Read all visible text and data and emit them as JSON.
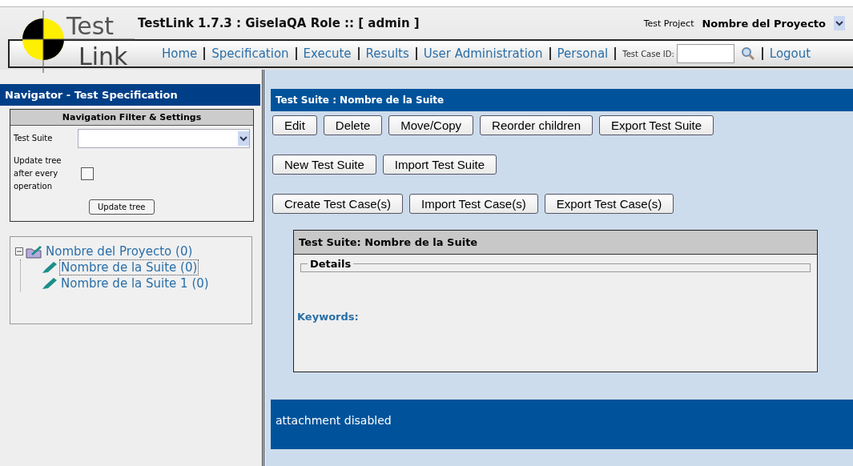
{
  "logo": {
    "line1": "Test",
    "line2": "Link"
  },
  "header": {
    "title": "TestLink 1.7.3 : GiselaQA Role :: [ admin ]",
    "project_label": "Test Project",
    "project_name": "Nombre del Proyecto"
  },
  "nav": {
    "links": [
      "Home",
      "Specification",
      "Execute",
      "Results",
      "User Administration",
      "Personal"
    ],
    "test_case_id_label": "Test Case ID:",
    "logout": "Logout"
  },
  "navigator": {
    "title": "Navigator - Test Specification",
    "filter_title": "Navigation Filter & Settings",
    "test_suite_label": "Test Suite",
    "update_label": "Update tree after every operation",
    "update_checked": false,
    "update_button": "Update tree"
  },
  "tree": [
    {
      "label": "Nombre del Proyecto (0)",
      "expanded": true,
      "selected": false,
      "children": [
        {
          "label": "Nombre de la Suite (0)",
          "selected": true
        },
        {
          "label": "Nombre de la Suite 1 (0)",
          "selected": false
        }
      ]
    }
  ],
  "main": {
    "title": "Test Suite : Nombre de la Suite",
    "button_rows": [
      [
        "Edit",
        "Delete",
        "Move/Copy",
        "Reorder children",
        "Export Test Suite"
      ],
      [
        "New Test Suite",
        "Import Test Suite"
      ],
      [
        "Create Test Case(s)",
        "Import Test Case(s)",
        "Export Test Case(s)"
      ]
    ],
    "card": {
      "title": "Test Suite: Nombre de la Suite",
      "details_legend": "Details",
      "keywords_label": "Keywords:"
    },
    "footer": "attachment disabled"
  }
}
